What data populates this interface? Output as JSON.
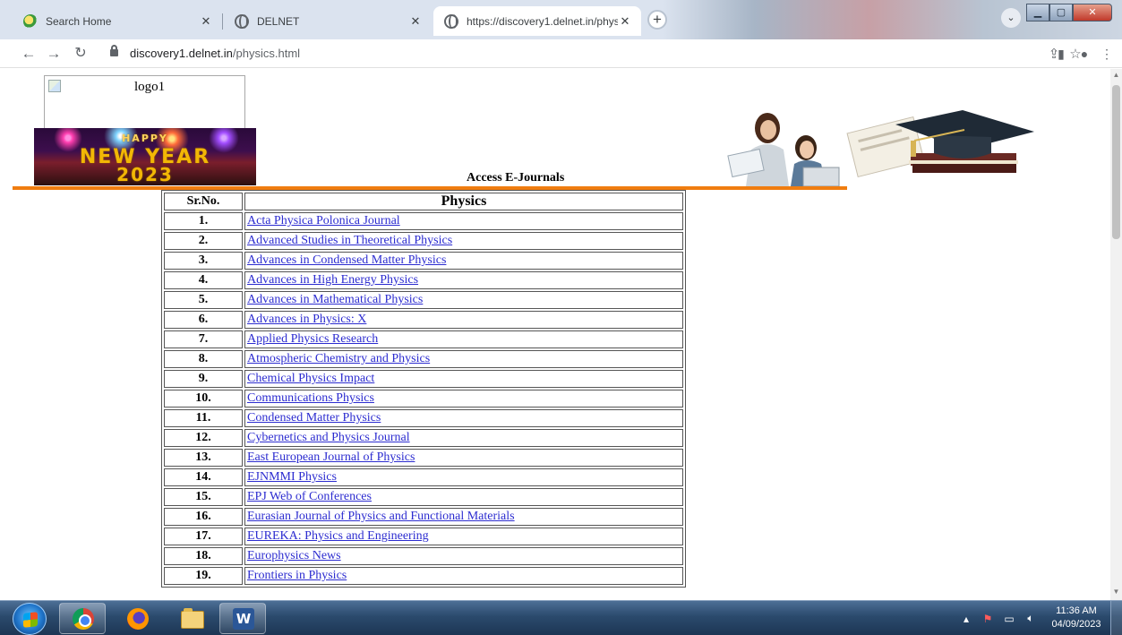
{
  "browser": {
    "tabs": [
      {
        "title": "Search Home",
        "favicon": "search-favicon",
        "active": false
      },
      {
        "title": "DELNET",
        "favicon": "globe-favicon",
        "active": false
      },
      {
        "title": "https://discovery1.delnet.in/phys",
        "favicon": "globe-favicon",
        "active": true
      }
    ],
    "tab_close_glyph": "✕",
    "new_tab_glyph": "+",
    "url_domain": "discovery1.delnet.in",
    "url_path": "/physics.html"
  },
  "page": {
    "logo_alt": "logo1",
    "banner_happy": "HAPPY",
    "banner_line1": "NEW YEAR",
    "banner_line2": "2023",
    "heading": "Access E-Journals",
    "table_headers": {
      "sr": "Sr.No.",
      "title": "Physics"
    },
    "journals": [
      {
        "num": "1.",
        "title": "Acta Physica Polonica Journal"
      },
      {
        "num": "2.",
        "title": "Advanced Studies in Theoretical Physics"
      },
      {
        "num": "3.",
        "title": "Advances in Condensed Matter Physics"
      },
      {
        "num": "4.",
        "title": "Advances in High Energy Physics"
      },
      {
        "num": "5.",
        "title": "Advances in Mathematical Physics"
      },
      {
        "num": "6.",
        "title": "Advances in Physics: X"
      },
      {
        "num": "7.",
        "title": "Applied Physics Research"
      },
      {
        "num": "8.",
        "title": "Atmospheric Chemistry and Physics"
      },
      {
        "num": "9.",
        "title": "Chemical Physics Impact"
      },
      {
        "num": "10.",
        "title": "Communications Physics"
      },
      {
        "num": "11.",
        "title": "Condensed Matter Physics"
      },
      {
        "num": "12.",
        "title": "Cybernetics and Physics Journal"
      },
      {
        "num": "13.",
        "title": "East European Journal of Physics"
      },
      {
        "num": "14.",
        "title": "EJNMMI Physics"
      },
      {
        "num": "15.",
        "title": "EPJ Web of Conferences"
      },
      {
        "num": "16.",
        "title": "Eurasian Journal of Physics and Functional Materials"
      },
      {
        "num": "17.",
        "title": "EUREKA: Physics and Engineering"
      },
      {
        "num": "18.",
        "title": "Europhysics News"
      },
      {
        "num": "19.",
        "title": "Frontiers in Physics"
      }
    ]
  },
  "taskbar": {
    "apps": [
      "chrome-icon",
      "firefox-icon",
      "file-explorer-icon",
      "word-icon"
    ],
    "word_glyph": "W",
    "clock_time": "11:36 AM",
    "clock_date": "04/09/2023"
  },
  "colors": {
    "accent_bar": "#f07d10",
    "link": "#2c2cd0"
  }
}
